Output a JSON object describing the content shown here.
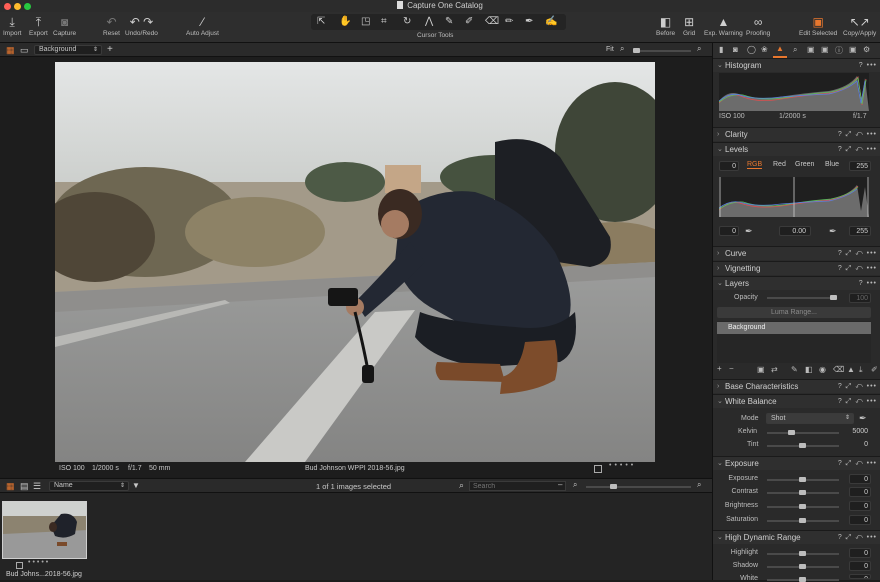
{
  "window": {
    "title": "Capture One Catalog"
  },
  "toolbar": {
    "left": [
      {
        "label": "Import",
        "icon": "download-icon"
      },
      {
        "label": "Export",
        "icon": "upload-icon"
      },
      {
        "label": "Capture",
        "icon": "camera-icon"
      }
    ],
    "reset": "Reset",
    "undo_redo": "Undo/Redo",
    "auto_adjust": "Auto Adjust",
    "cursor_tools": "Cursor Tools",
    "right": [
      {
        "label": "Before"
      },
      {
        "label": "Grid"
      },
      {
        "label": "Exp. Warning"
      },
      {
        "label": "Proofing"
      },
      {
        "label": "Edit Selected"
      },
      {
        "label": "Copy/Apply"
      }
    ]
  },
  "subbar": {
    "layer_select": "Background",
    "fit_label": "Fit"
  },
  "viewer": {
    "iso": "ISO 100",
    "shutter": "1/2000 s",
    "aperture": "f/1.7",
    "focal": "50 mm",
    "filename": "Bud Johnson WPPI 2018-56.jpg"
  },
  "browser": {
    "sort": "Name",
    "count_text": "1 of 1 images selected",
    "search_placeholder": "Search",
    "thumb_name": "Bud Johns...2018-56.jpg"
  },
  "panel": {
    "histogram": {
      "title": "Histogram",
      "iso": "ISO 100",
      "shutter": "1/2000 s",
      "aperture": "f/1.7"
    },
    "clarity": "Clarity",
    "levels": {
      "title": "Levels",
      "low": "0",
      "high": "255",
      "tabs": [
        "RGB",
        "Red",
        "Green",
        "Blue"
      ],
      "out_low": "0",
      "mid": "0.00",
      "out_high": "255"
    },
    "curve": "Curve",
    "vignetting": "Vignetting",
    "layers": {
      "title": "Layers",
      "opacity_label": "Opacity",
      "opacity_value": "100",
      "luma_range": "Luma Range...",
      "layer_name": "Background"
    },
    "base_characteristics": "Base Characteristics",
    "white_balance": {
      "title": "White Balance",
      "mode_label": "Mode",
      "mode_value": "Shot",
      "kelvin_label": "Kelvin",
      "kelvin_value": "5000",
      "tint_label": "Tint",
      "tint_value": "0"
    },
    "exposure": {
      "title": "Exposure",
      "rows": [
        {
          "label": "Exposure",
          "value": "0"
        },
        {
          "label": "Contrast",
          "value": "0"
        },
        {
          "label": "Brightness",
          "value": "0"
        },
        {
          "label": "Saturation",
          "value": "0"
        }
      ]
    },
    "hdr": {
      "title": "High Dynamic Range",
      "rows": [
        {
          "label": "Highlight",
          "value": "0"
        },
        {
          "label": "Shadow",
          "value": "0"
        },
        {
          "label": "White",
          "value": "0"
        }
      ]
    }
  },
  "colors": {
    "accent": "#e8772e",
    "panel": "#2a2a2a",
    "viewer": "#1d1d1d"
  }
}
